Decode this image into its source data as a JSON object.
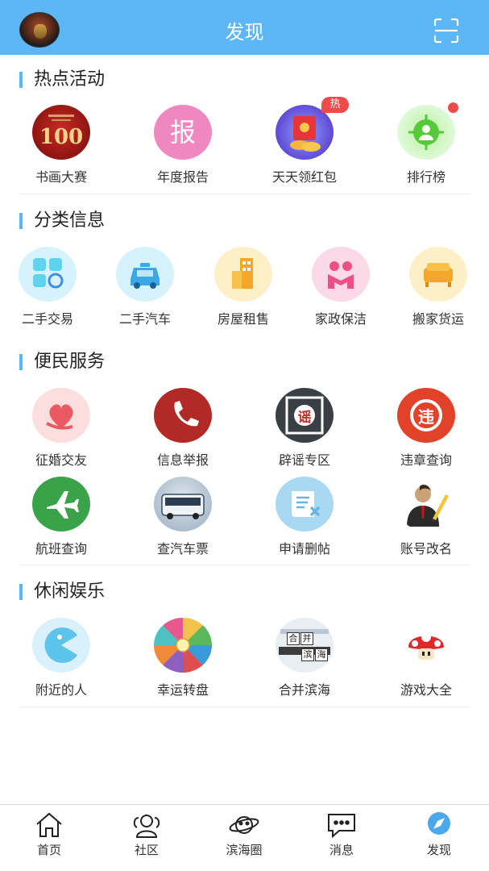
{
  "header": {
    "title": "发现"
  },
  "sections": {
    "hot": {
      "title": "热点活动",
      "items": [
        "书画大赛",
        "年度报告",
        "天天领红包",
        "排行榜"
      ],
      "badge": "热",
      "report_glyph": "报"
    },
    "category": {
      "title": "分类信息",
      "items": [
        "二手交易",
        "二手汽车",
        "房屋租售",
        "家政保洁",
        "搬家货运"
      ]
    },
    "service": {
      "title": "便民服务",
      "items": [
        "征婚交友",
        "信息举报",
        "辟谣专区",
        "违章查询",
        "航班查询",
        "查汽车票",
        "申请删帖",
        "账号改名"
      ],
      "rumor_glyph": "谣",
      "violation_glyph": "违"
    },
    "leisure": {
      "title": "休闲娱乐",
      "items": [
        "附近的人",
        "幸运转盘",
        "合并滨海",
        "游戏大全"
      ],
      "merge_glyphs": [
        "合",
        "并",
        "滨",
        "海"
      ]
    }
  },
  "tabbar": {
    "items": [
      "首页",
      "社区",
      "滨海圈",
      "消息",
      "发现"
    ],
    "active": "发现"
  },
  "colors": {
    "primary": "#5db6f5",
    "badge": "#ef4a4a"
  }
}
